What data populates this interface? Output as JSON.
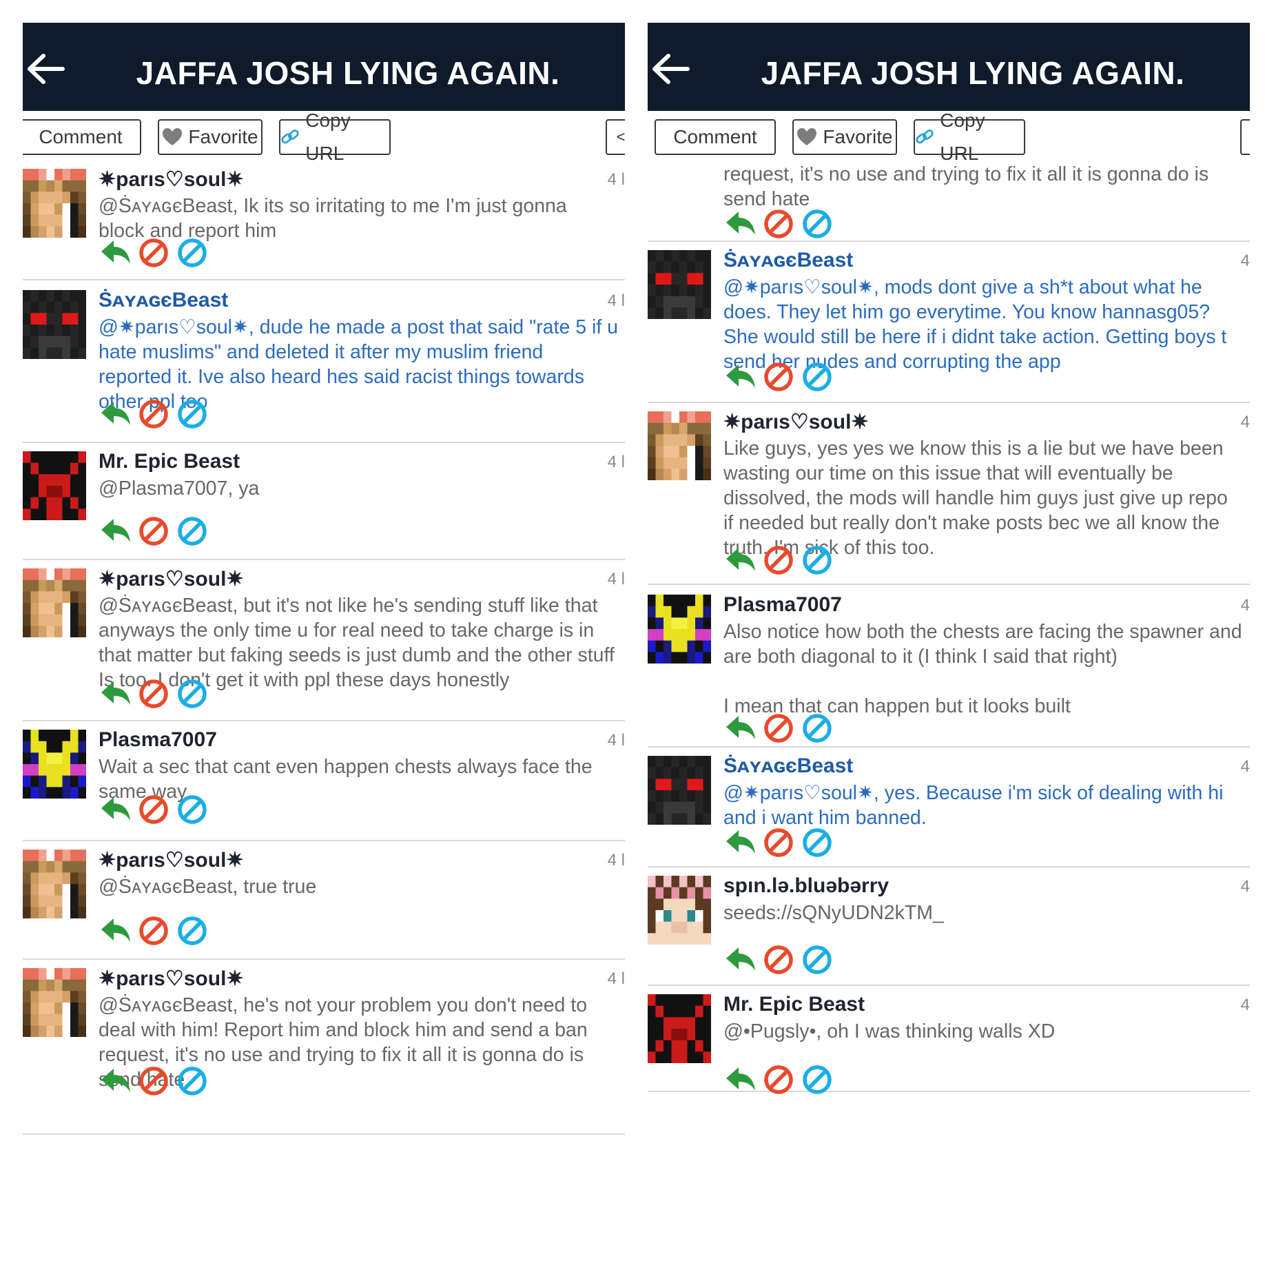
{
  "colors": {
    "header_bg": "#0f1b2a",
    "reply_green": "#2e9a3f",
    "block_red": "#e84a2b",
    "report_blue": "#1aaee6",
    "mod_text_blue": "#2b6cbf"
  },
  "panes": [
    {
      "header": {
        "title": "JAFFA JOSH LYING AGAIN."
      },
      "toolbar": {
        "comment": "Comment",
        "favorite": "Favorite",
        "copy_url": "Copy URL"
      },
      "comments": [
        {
          "user": "✷parıs♡soul✷",
          "time": "4 l",
          "text": "@ṠᴀʏᴀɢєBeast, Ik its so irritating to me I'm just gonna block and report him",
          "blue": false,
          "avatar": "paris"
        },
        {
          "user": "ṠᴀʏᴀɢєBeast",
          "time": "4 l",
          "text": "@✷parıs♡soul✷, dude he made a post that said \"rate 5 if u hate muslims\" and deleted it after my muslim friend reported it. Ive also heard hes said racist things towards other ppl too",
          "blue": true,
          "avatar": "savage"
        },
        {
          "user": "Mr. Epic Beast",
          "time": "4 l",
          "text": "@Plasma7007, ya",
          "blue": false,
          "avatar": "epic"
        },
        {
          "user": "✷parıs♡soul✷",
          "time": "4 l",
          "text": "@ṠᴀʏᴀɢєBeast, but it's not like he's sending stuff like that anyways the only time u for real need to take charge is in that matter but faking seeds is just dumb and the other stuff Is too. I don't get it with ppl these days honestly",
          "blue": false,
          "avatar": "paris"
        },
        {
          "user": "Plasma7007",
          "time": "4 l",
          "text": "Wait a sec that cant even happen chests always face the same way",
          "blue": false,
          "avatar": "plasma"
        },
        {
          "user": "✷parıs♡soul✷",
          "time": "4 l",
          "text": "@ṠᴀʏᴀɢєBeast, true true",
          "blue": false,
          "avatar": "paris"
        },
        {
          "user": "✷parıs♡soul✷",
          "time": "4 l",
          "text": "@ṠᴀʏᴀɢєBeast, he's not your problem you don't need to deal with him! Report him and block him and send a ban request, it's no use and trying to fix it all it is gonna do is send hate",
          "blue": false,
          "avatar": "paris"
        }
      ]
    },
    {
      "header": {
        "title": "JAFFA JOSH LYING AGAIN."
      },
      "toolbar": {
        "comment": "Comment",
        "favorite": "Favorite",
        "copy_url": "Copy URL"
      },
      "partial_text": "request, it's no use and trying to fix it all it is gonna do is send hate",
      "comments": [
        {
          "user": "ṠᴀʏᴀɢєBeast",
          "time": "4",
          "text": "@✷parıs♡soul✷, mods dont give a sh*t about what he does. They let him go everytime. You know hannasg05? She would still be here if i didnt take action. Getting boys t send her nudes and corrupting the app",
          "blue": true,
          "avatar": "savage"
        },
        {
          "user": "✷parıs♡soul✷",
          "time": "4",
          "text": "Like guys, yes yes we know this is a lie but we have been wasting our time on this issue that will eventually be dissolved, the mods will handle him guys just give up repo if needed but really don't make posts bec we all know the truth. I'm sick of this too.",
          "blue": false,
          "avatar": "paris"
        },
        {
          "user": "Plasma7007",
          "time": "4",
          "text": "Also notice how both the chests are facing the spawner and are both diagonal to it (I think I said that right)\n\nI mean that can happen but it looks built",
          "blue": false,
          "avatar": "plasma"
        },
        {
          "user": "ṠᴀʏᴀɢєBeast",
          "time": "4",
          "text": "@✷parıs♡soul✷, yes. Because i'm sick of dealing with hi and i want him banned.",
          "blue": true,
          "avatar": "savage"
        },
        {
          "user": "spın.lə.bluəbərry",
          "time": "4",
          "text": "seeds://sQNyUDN2kTM_",
          "blue": false,
          "avatar": "blueberry"
        },
        {
          "user": "Mr. Epic Beast",
          "time": "4",
          "text": "@•Pugsly•, oh I was thinking walls XD",
          "blue": false,
          "avatar": "epic"
        }
      ]
    }
  ]
}
